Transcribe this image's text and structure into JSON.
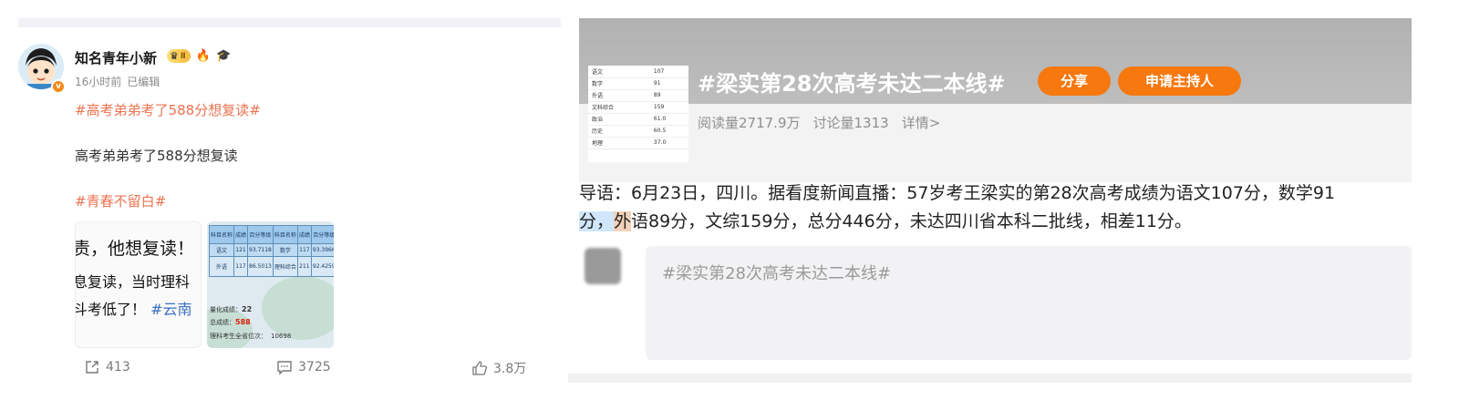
{
  "post": {
    "username": "知名青年小新",
    "vip_text": "Ⅱ",
    "time": "16小时前",
    "edited": "已编辑",
    "hashtag_top": "#高考弟弟考了588分想复读#",
    "body": "高考弟弟考了588分想复读",
    "hashtag_bottom": "#青春不留白#",
    "thumb1": {
      "line1": "责，他想复读！",
      "line2": "息复读，当时理科",
      "line3_text": "斗考低了！",
      "line3_tag": "#云南"
    },
    "thumb2": {
      "table": [
        [
          "科目名称",
          "成绩",
          "百分等级",
          "科目名称",
          "成绩",
          "百分等级"
        ],
        [
          "语文",
          "121",
          "93.7118",
          "数学",
          "117",
          "93.3966"
        ],
        [
          "外语",
          "117",
          "86.5013",
          "理科综合",
          "211",
          "92.4259"
        ]
      ],
      "quant_label": "量化成绩：",
      "quant_value": "22",
      "total_label": "总成绩：",
      "total_value": "588",
      "rank_label": "理科考生全省位次：",
      "rank_value": "10698"
    },
    "actions": {
      "share_count": "413",
      "comment_count": "3725",
      "like_count": "3.8万"
    }
  },
  "topic": {
    "title": "#梁实第28次高考未达二本线#",
    "share_label": "分享",
    "host_label": "申请主持人",
    "reads": "阅读量2717.9万",
    "discussions": "讨论量1313",
    "details": "详情>",
    "thumb_scores": [
      [
        "语文",
        "107"
      ],
      [
        "数学",
        "91"
      ],
      [
        "外语",
        "89"
      ],
      [
        "文科综合",
        "159"
      ],
      [
        "政治",
        "61.0"
      ],
      [
        "历史",
        "60.5"
      ],
      [
        "地理",
        "37.0"
      ]
    ],
    "intro_a": "导语：6月23日，四川。据看度新闻直播：57岁考王梁实的第28次高考成绩为语文107分，数学91",
    "intro_b1": "分，",
    "intro_b2": "外",
    "intro_b3": "语89分，文综159分，总分446分，未达四川省本科二批线，相差11分。",
    "comment_placeholder": "#梁实第28次高考未达二本线#"
  },
  "colors": {
    "hashtag": "#eb7350",
    "accent_button": "#f7780f",
    "muted_text": "#8a8a8a"
  },
  "icons": [
    "avatar",
    "crown-icon",
    "flame-icon",
    "grad-cap-icon",
    "share-icon",
    "comment-icon",
    "like-icon"
  ]
}
